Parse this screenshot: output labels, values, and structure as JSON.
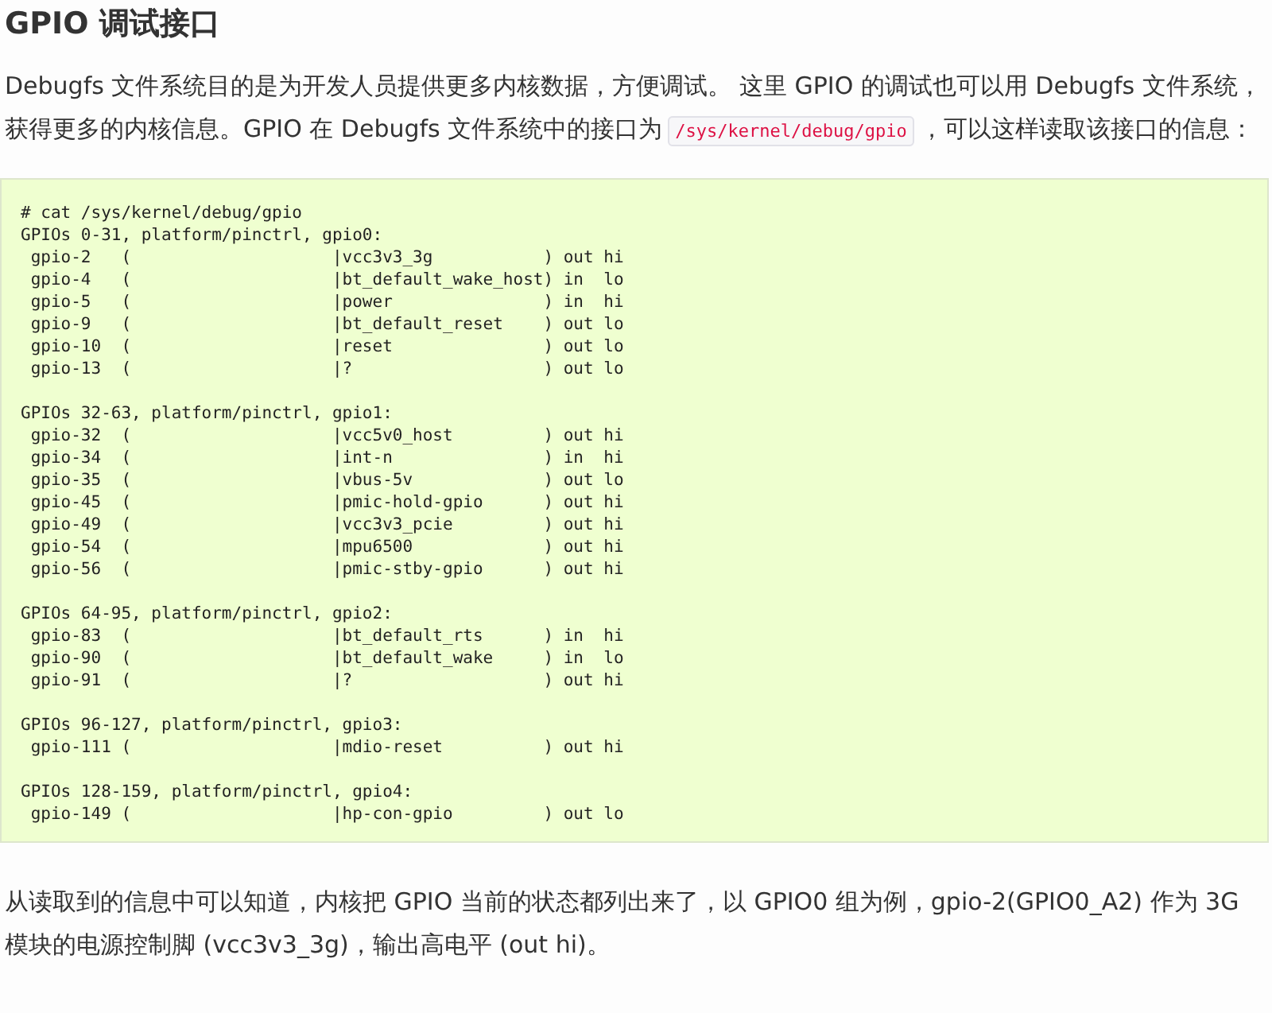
{
  "heading": "GPIO 调试接口",
  "intro": {
    "before": "Debugfs 文件系统目的是为开发人员提供更多内核数据，方便调试。 这里 GPIO 的调试也可以用 Debugfs 文件系统，获得更多的内核信息。GPIO 在 Debugfs 文件系统中的接口为",
    "code": "/sys/kernel/debug/gpio",
    "after": "，可以这样读取该接口的信息："
  },
  "code_block": {
    "command": "# cat /sys/kernel/debug/gpio",
    "sections": [
      {
        "header": "GPIOs 0-31, platform/pinctrl, gpio0:",
        "rows": [
          " gpio-2   (                    |vcc3v3_3g           ) out hi",
          " gpio-4   (                    |bt_default_wake_host) in  lo",
          " gpio-5   (                    |power               ) in  hi",
          " gpio-9   (                    |bt_default_reset    ) out lo",
          " gpio-10  (                    |reset               ) out lo",
          " gpio-13  (                    |?                   ) out lo"
        ]
      },
      {
        "header": "GPIOs 32-63, platform/pinctrl, gpio1:",
        "rows": [
          " gpio-32  (                    |vcc5v0_host         ) out hi",
          " gpio-34  (                    |int-n               ) in  hi",
          " gpio-35  (                    |vbus-5v             ) out lo",
          " gpio-45  (                    |pmic-hold-gpio      ) out hi",
          " gpio-49  (                    |vcc3v3_pcie         ) out hi",
          " gpio-54  (                    |mpu6500             ) out hi",
          " gpio-56  (                    |pmic-stby-gpio      ) out hi"
        ]
      },
      {
        "header": "GPIOs 64-95, platform/pinctrl, gpio2:",
        "rows": [
          " gpio-83  (                    |bt_default_rts      ) in  hi",
          " gpio-90  (                    |bt_default_wake     ) in  lo",
          " gpio-91  (                    |?                   ) out hi"
        ]
      },
      {
        "header": "GPIOs 96-127, platform/pinctrl, gpio3:",
        "rows": [
          " gpio-111 (                    |mdio-reset          ) out hi"
        ]
      },
      {
        "header": "GPIOs 128-159, platform/pinctrl, gpio4:",
        "rows": [
          " gpio-149 (                    |hp-con-gpio         ) out lo"
        ]
      }
    ]
  },
  "outro": "从读取到的信息中可以知道，内核把 GPIO 当前的状态都列出来了，以 GPIO0 组为例，gpio-2(GPIO0_A2) 作为 3G 模块的电源控制脚 (vcc3v3_3g)，输出高电平 (out hi)。"
}
